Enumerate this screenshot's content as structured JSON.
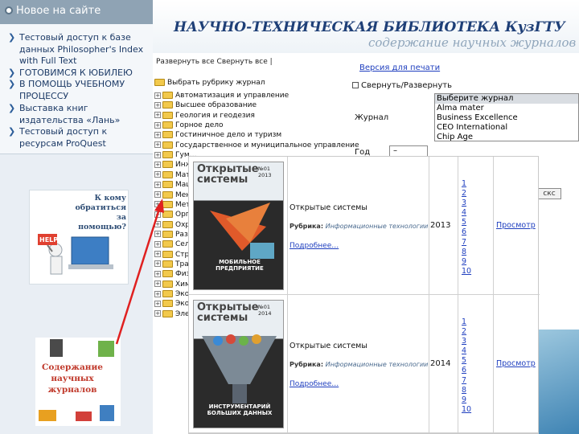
{
  "sidebar": {
    "news_header": "Новое на сайте",
    "news": [
      "Тестовый доступ к базе данных Philosopher's Index with Full Text",
      "ГОТОВИМСЯ К ЮБИЛЕЮ",
      "В ПОМОЩЬ УЧЕБНОМУ ПРОЦЕССУ",
      "Выставка книг издательства «Лань»",
      "Тестовый доступ к ресурсам ProQuest"
    ],
    "help_banner": {
      "question": "К кому обратиться за помощью?",
      "sign": "HELP"
    },
    "journals_banner": {
      "text": "Содержание научных журналов"
    }
  },
  "header": {
    "title": "НАУЧНО-ТЕХНИЧЕСКАЯ БИБЛИОТЕКА КузГТУ",
    "subtitle": "содержание научных журналов"
  },
  "tree": {
    "intro": "Развернуть все  Свернуть все |",
    "select_label": "Выбрать рубрику журнал",
    "rubrics": [
      "Автоматизация и управление",
      "Высшее образование",
      "Геология и геодезия",
      "Горное дело",
      "Гостиничное дело и туризм",
      "Государственное и муниципальное управление",
      "Гум…",
      "Инж…",
      "Мат…",
      "Маш…",
      "Мен…",
      "Мет…",
      "Орг…",
      "Охр…",
      "Раз…",
      "Сел…",
      "Стр…",
      "Тра…",
      "Физ…",
      "Хим…",
      "Эко…",
      "Эко…",
      "Эле…"
    ]
  },
  "form": {
    "print_link": "Версия для печати",
    "expand_label": "Свернуть/Развернуть",
    "journal_label": "Журнал",
    "journal_options": [
      "Выберите журнал",
      "Alma mater",
      "Business Excellence",
      "CEO International",
      "Chip Age"
    ],
    "year_label": "Год",
    "year_value": "–",
    "search_button": "скс"
  },
  "results": [
    {
      "cover_title": "Открытые системы",
      "cover_number": "№01 2013",
      "cover_headline": "МОБИЛЬНОЕ ПРЕДПРИЯТИЕ",
      "title": "Открытые системы",
      "rubric_label": "Рубрика:",
      "rubric": "Информационные технологии",
      "more": "Подробнее…",
      "year": "2013",
      "issues": [
        "1",
        "2",
        "3",
        "4",
        "5",
        "6",
        "7",
        "8",
        "9",
        "10"
      ],
      "view": "Просмотр"
    },
    {
      "cover_title": "Открытые системы",
      "cover_number": "№01 2014",
      "cover_headline": "ИНСТРУМЕНТАРИЙ БОЛЬШИХ ДАННЫХ",
      "title": "Открытые системы",
      "rubric_label": "Рубрика:",
      "rubric": "Информационные технологии",
      "more": "Подробнее…",
      "year": "2014",
      "issues": [
        "1",
        "2",
        "3",
        "4",
        "5",
        "6",
        "7",
        "8",
        "9",
        "10"
      ],
      "view": "Просмотр"
    }
  ],
  "colors": {
    "brand": "#1e3f77",
    "link": "#1f3fbf",
    "arrow": "#e02020",
    "folder": "#f2c94c"
  }
}
